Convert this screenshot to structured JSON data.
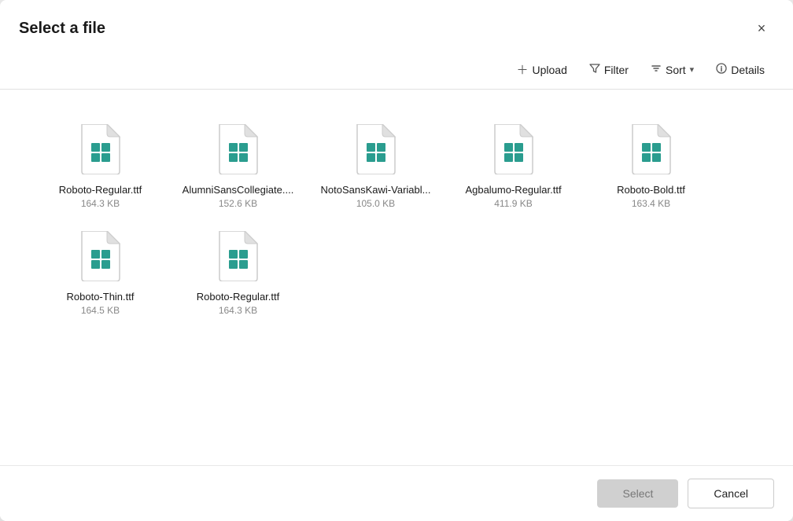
{
  "dialog": {
    "title": "Select a file",
    "close_label": "×"
  },
  "toolbar": {
    "upload_label": "Upload",
    "filter_label": "Filter",
    "sort_label": "Sort",
    "details_label": "Details"
  },
  "files": [
    {
      "name": "Roboto-Regular.ttf",
      "size": "164.3 KB"
    },
    {
      "name": "AlumniSansCollegiate....",
      "size": "152.6 KB"
    },
    {
      "name": "NotoSansKawi-Variabl...",
      "size": "105.0 KB"
    },
    {
      "name": "Agbalumo-Regular.ttf",
      "size": "411.9 KB"
    },
    {
      "name": "Roboto-Bold.ttf",
      "size": "163.4 KB"
    },
    {
      "name": "Roboto-Thin.ttf",
      "size": "164.5 KB"
    },
    {
      "name": "Roboto-Regular.ttf",
      "size": "164.3 KB"
    }
  ],
  "footer": {
    "select_label": "Select",
    "cancel_label": "Cancel"
  }
}
